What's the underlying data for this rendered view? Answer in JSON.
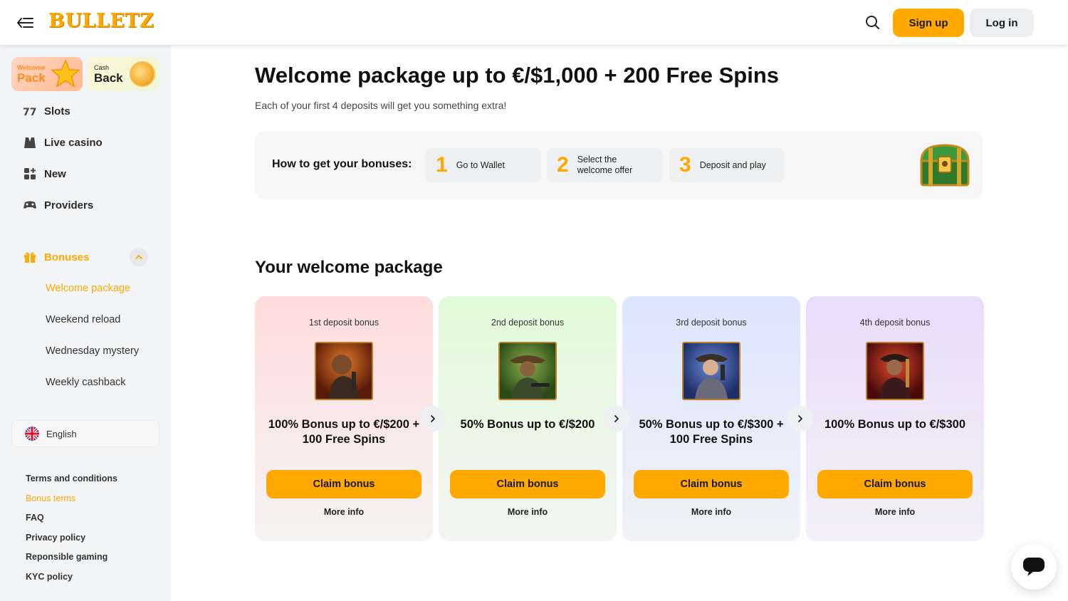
{
  "header": {
    "logo": "BULLETZ",
    "signup": "Sign up",
    "login": "Log in"
  },
  "sidebar": {
    "promos": [
      {
        "small": "Welcome",
        "big": "Pack"
      },
      {
        "small": "Cash",
        "big": "Back"
      }
    ],
    "nav": [
      {
        "label": "Slots",
        "icon": "slots-icon"
      },
      {
        "label": "Live casino",
        "icon": "live-casino-icon"
      },
      {
        "label": "New",
        "icon": "new-icon"
      },
      {
        "label": "Providers",
        "icon": "providers-icon"
      }
    ],
    "bonuses": {
      "label": "Bonuses",
      "items": [
        "Welcome package",
        "Weekend reload",
        "Wednesday mystery",
        "Weekly cashback"
      ],
      "active": "Welcome package"
    },
    "language": "English",
    "footer_links": [
      "Terms and conditions",
      "Bonus terms",
      "FAQ",
      "Privacy policy",
      "Reponsible gaming",
      "KYC policy"
    ]
  },
  "main": {
    "title": "Welcome package up to €/$1,000 + 200 Free Spins",
    "subtitle": "Each of your first 4 deposits will get you something extra!",
    "howto": {
      "label": "How to get your bonuses:",
      "steps": [
        {
          "num": "1",
          "text": "Go to Wallet"
        },
        {
          "num": "2",
          "text": "Select the welcome offer"
        },
        {
          "num": "3",
          "text": "Deposit and play"
        }
      ]
    },
    "section_title": "Your welcome package",
    "cards": [
      {
        "label": "1st deposit bonus",
        "title": "100% Bonus up to €/$200 + 100 Free Spins",
        "button": "Claim bonus",
        "more": "More info"
      },
      {
        "label": "2nd deposit bonus",
        "title": "50% Bonus up to €/$200",
        "button": "Claim bonus",
        "more": "More info"
      },
      {
        "label": "3rd deposit bonus",
        "title": "50% Bonus up to €/$300 + 100 Free Spins",
        "button": "Claim bonus",
        "more": "More info"
      },
      {
        "label": "4th deposit bonus",
        "title": "100% Bonus up to €/$300",
        "button": "Claim bonus",
        "more": "More info"
      }
    ]
  },
  "colors": {
    "accent": "#ffa800",
    "sidebar_bg": "#f3f4f6"
  }
}
